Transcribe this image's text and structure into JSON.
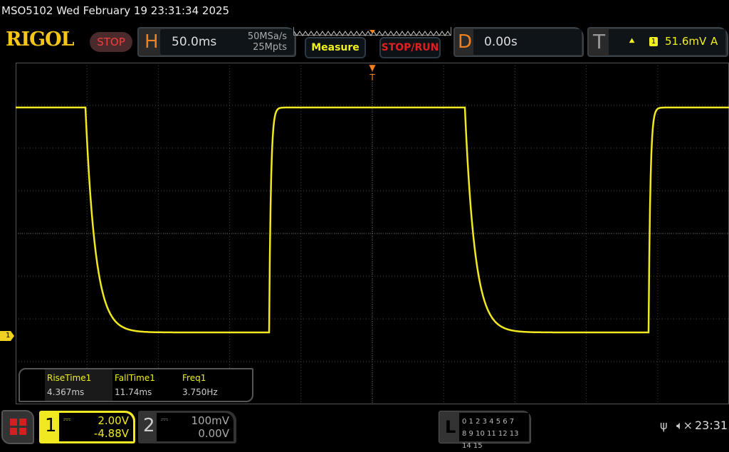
{
  "title": "MSO5102  Wed February 19 23:31:34 2025",
  "logo": "RIGOL",
  "run_state": "STOP",
  "horizontal": {
    "letter": "H",
    "timebase": "50.0ms",
    "sample_rate": "50MSa/s",
    "memory_depth": "25Mpts"
  },
  "buttons": {
    "measure": "Measure",
    "stop_run": "STOP/RUN"
  },
  "delay": {
    "letter": "D",
    "value": "0.00s"
  },
  "trigger": {
    "letter": "T",
    "edge_icon": "rising-edge-icon",
    "channel": "1",
    "level": "51.6mV",
    "mode": "A"
  },
  "channel_marker": "1",
  "measurements": [
    {
      "label": "RiseTime1",
      "value": "4.367ms"
    },
    {
      "label": "FallTime1",
      "value": "11.74ms"
    },
    {
      "label": "Freq1",
      "value": "3.750Hz"
    }
  ],
  "ch1": {
    "num": "1",
    "coupling_icon": "dc-icon",
    "scale": "2.00V",
    "offset": "-4.88V",
    "color": "#f0e820"
  },
  "ch2": {
    "num": "2",
    "coupling_icon": "dc-icon",
    "scale": "100mV",
    "offset": "0.00V"
  },
  "logic": {
    "letter": "L",
    "row1": "0 1 2 3  4 5 6 7",
    "row2": "8 9 10 11 12 13 14 15"
  },
  "status": {
    "usb_icon": "usb-icon",
    "mute_icon": "speaker-muted-icon",
    "time": "23:31"
  }
}
